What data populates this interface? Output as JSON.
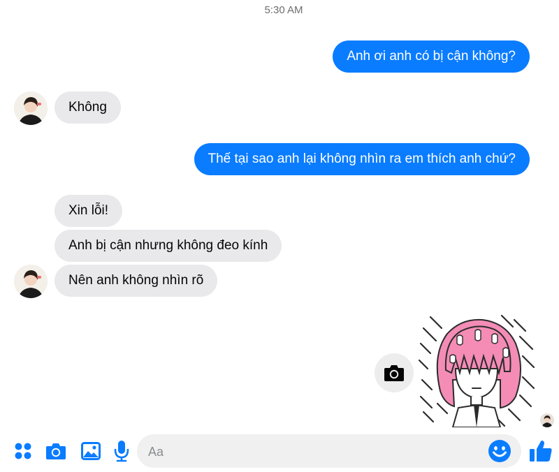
{
  "timestamp": "5:30 AM",
  "messages": [
    {
      "from": "me",
      "text": "Anh ơi anh có bị cận không?"
    },
    {
      "from": "them",
      "text": "Không"
    },
    {
      "from": "me",
      "text": "Thế tại sao anh lại không nhìn ra em thích anh chứ?"
    },
    {
      "from": "them",
      "text": "Xin lỗi!"
    },
    {
      "from": "them",
      "text": "Anh bị cận nhưng không đeo kính"
    },
    {
      "from": "them",
      "text": "Nên anh không nhìn rõ"
    }
  ],
  "composer": {
    "placeholder": "Aa"
  },
  "icons": {
    "toolbar": [
      "apps-grid-icon",
      "camera-icon",
      "gallery-icon",
      "microphone-icon"
    ],
    "emoji": "smiley-icon",
    "send": "thumbs-up-icon",
    "sticker_action": "camera-icon"
  },
  "colors": {
    "accent": "#0a7cff",
    "incoming_bubble": "#e9e9eb",
    "sticker_hair": "#f48cb6"
  }
}
